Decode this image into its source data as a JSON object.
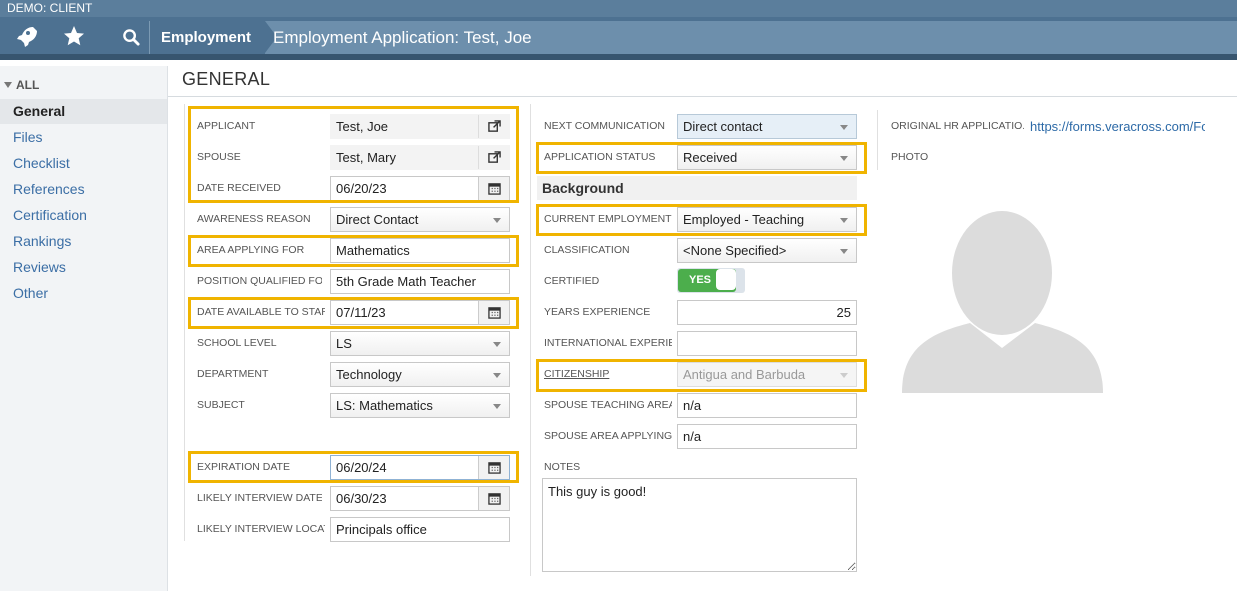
{
  "app": {
    "client_label": "DEMO: CLIENT"
  },
  "breadcrumb": {
    "module": "Employment",
    "title": "Employment Application: Test, Joe"
  },
  "sidebar": {
    "all_label": "ALL",
    "items": [
      {
        "label": "General"
      },
      {
        "label": "Files"
      },
      {
        "label": "Checklist"
      },
      {
        "label": "References"
      },
      {
        "label": "Certification"
      },
      {
        "label": "Rankings"
      },
      {
        "label": "Reviews"
      },
      {
        "label": "Other"
      }
    ]
  },
  "page": {
    "title": "GENERAL"
  },
  "left": {
    "applicant": {
      "label": "APPLICANT",
      "value": "Test, Joe"
    },
    "spouse": {
      "label": "SPOUSE",
      "value": "Test, Mary"
    },
    "date_received": {
      "label": "DATE RECEIVED",
      "value": "06/20/23"
    },
    "awareness_reason": {
      "label": "AWARENESS REASON",
      "value": "Direct Contact"
    },
    "area_applying": {
      "label": "AREA APPLYING FOR",
      "value": "Mathematics"
    },
    "position_qualified": {
      "label": "POSITION QUALIFIED FOR",
      "value": "5th Grade Math Teacher"
    },
    "date_available": {
      "label": "DATE AVAILABLE TO START",
      "value": "07/11/23"
    },
    "school_level": {
      "label": "SCHOOL LEVEL",
      "value": "LS"
    },
    "department": {
      "label": "DEPARTMENT",
      "value": "Technology"
    },
    "subject": {
      "label": "SUBJECT",
      "value": "LS: Mathematics"
    },
    "expiration_date": {
      "label": "EXPIRATION DATE",
      "value": "06/20/24"
    },
    "likely_interview_date": {
      "label": "LIKELY INTERVIEW DATE",
      "value": "06/30/23"
    },
    "likely_interview_location": {
      "label": "LIKELY INTERVIEW LOCAT...",
      "value": "Principals office"
    }
  },
  "middle": {
    "next_communication": {
      "label": "NEXT COMMUNICATION",
      "value": "Direct contact"
    },
    "application_status": {
      "label": "APPLICATION STATUS",
      "value": "Received"
    },
    "background_heading": "Background",
    "current_employment": {
      "label": "CURRENT EMPLOYMENT ...",
      "value": "Employed - Teaching"
    },
    "classification": {
      "label": "CLASSIFICATION",
      "value": "<None Specified>"
    },
    "certified": {
      "label": "CERTIFIED",
      "value": "YES"
    },
    "years_experience": {
      "label": "YEARS EXPERIENCE",
      "value": "25"
    },
    "international_experience": {
      "label": "INTERNATIONAL EXPERIE...",
      "value": ""
    },
    "citizenship": {
      "label": "CITIZENSHIP",
      "value": "Antigua and Barbuda"
    },
    "spouse_teaching_area": {
      "label": "SPOUSE TEACHING AREA",
      "value": "n/a"
    },
    "spouse_area_applying": {
      "label": "SPOUSE AREA APPLYING ...",
      "value": "n/a"
    },
    "notes": {
      "label": "NOTES",
      "value": "This guy is good!"
    }
  },
  "right": {
    "original_hr_application": {
      "label": "ORIGINAL HR APPLICATIO...",
      "value": "https://forms.veracross.com/Forr"
    },
    "photo": {
      "label": "PHOTO"
    }
  },
  "colors": {
    "nav": "#4d7191",
    "highlight": "#f0b400",
    "toggle_on": "#4cae4c",
    "link": "#2d6aa7"
  }
}
